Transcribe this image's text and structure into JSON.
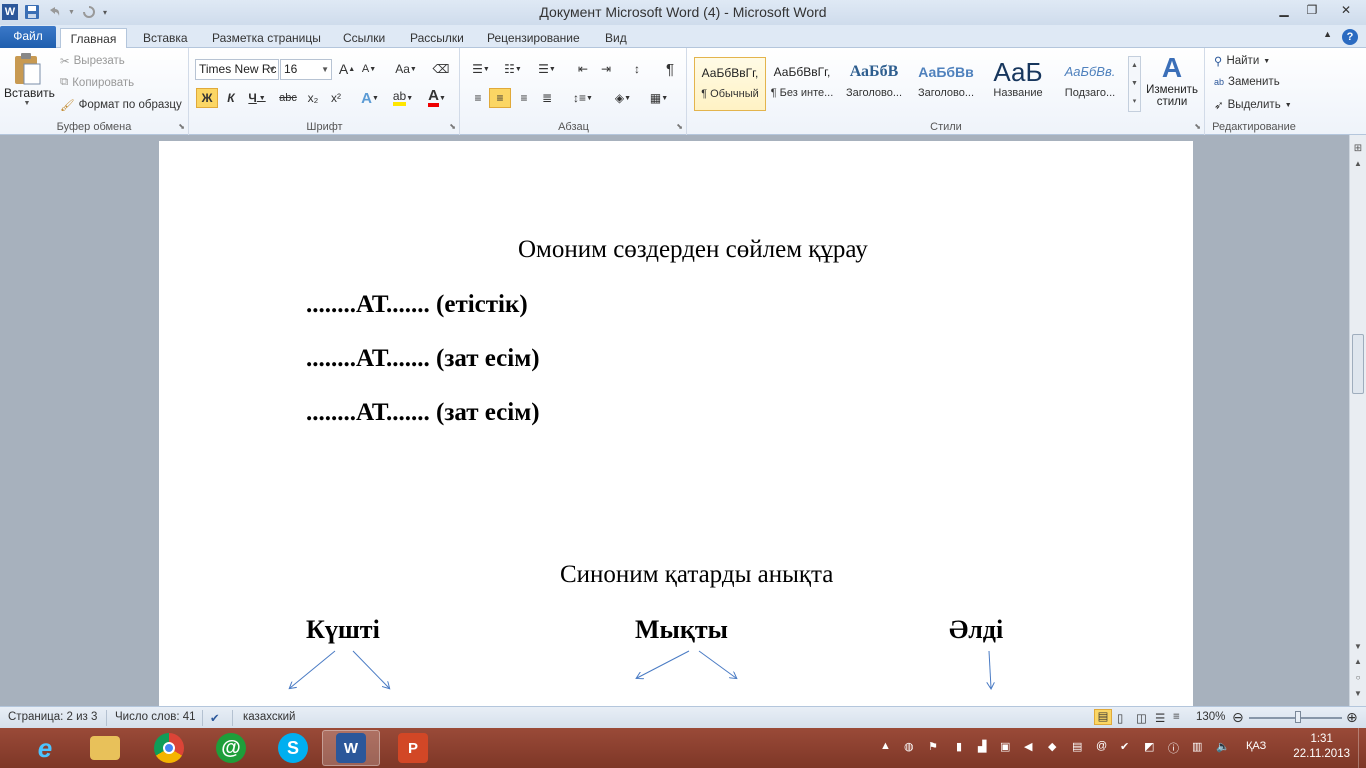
{
  "app": {
    "title": "Документ Microsoft Word (4)  -  Microsoft Word",
    "colors": {
      "file_tab": "#2b579a",
      "taskbar": "#8b3f2e",
      "highlight": "#fbd664"
    }
  },
  "tabs": [
    "Файл",
    "Главная",
    "Вставка",
    "Разметка страницы",
    "Ссылки",
    "Рассылки",
    "Рецензирование",
    "Вид"
  ],
  "ribbon": {
    "clipboard": {
      "label": "Буфер обмена",
      "paste": "Вставить",
      "cut": "Вырезать",
      "copy": "Копировать",
      "format_painter": "Формат по образцу"
    },
    "font": {
      "label": "Шрифт",
      "font_name": "Times New Rc",
      "font_size": "16",
      "case": "Aa",
      "bold": "Ж",
      "italic": "К",
      "underline": "Ч",
      "strike": "abc",
      "sub": "x₂",
      "sup": "x²",
      "grow": "A",
      "shrink": "A",
      "effects": "A",
      "highlight": "ab",
      "color": "A"
    },
    "paragraph": {
      "label": "Абзац",
      "pilcrow": "¶"
    },
    "styles": {
      "label": "Стили",
      "items": [
        {
          "sample": "АаБбВвГг,",
          "name": "¶ Обычный"
        },
        {
          "sample": "АаБбВвГг,",
          "name": "¶ Без инте..."
        },
        {
          "sample": "АаБбВ",
          "name": "Заголово..."
        },
        {
          "sample": "АаБбВв",
          "name": "Заголово..."
        },
        {
          "sample": "АаБ",
          "name": "Название"
        },
        {
          "sample": "АаБбВв.",
          "name": "Подзаго..."
        }
      ],
      "change": "Изменить стили"
    },
    "editing": {
      "label": "Редактирование",
      "find": "Найти",
      "replace": "Заменить",
      "select": "Выделить"
    }
  },
  "document": {
    "heading1": "Омоним сөздерден сөйлем құрау",
    "line1": "........АТ....... (етістік)",
    "line2": "........АТ....... (зат есім)",
    "line3": "........АТ....... (зат есім)",
    "heading2": "Синоним қатарды анықта",
    "word1": "Күшті",
    "word2": "Мықты",
    "word3": "Әлді"
  },
  "statusbar": {
    "page": "Страница: 2 из 3",
    "words": "Число слов: 41",
    "language": "казахский",
    "zoom": "130%"
  },
  "taskbar": {
    "lang": "ҚАЗ",
    "time": "1:31",
    "date": "22.11.2013",
    "apps": [
      "internet-explorer-icon",
      "explorer-icon",
      "chrome-icon",
      "mail-agent-icon",
      "skype-icon",
      "word-icon",
      "powerpoint-icon"
    ]
  }
}
